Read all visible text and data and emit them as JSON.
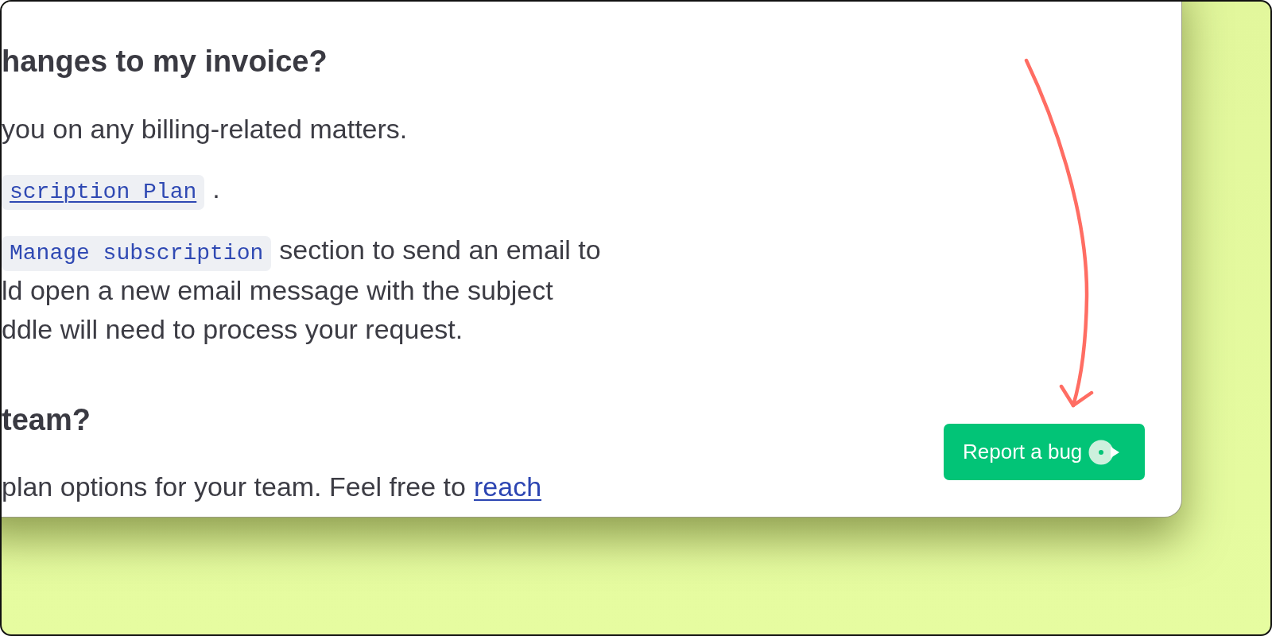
{
  "sections": [
    {
      "heading": "hanges to my invoice?",
      "blocks": [
        {
          "lines": [
            [
              {
                "kind": "text",
                "text": "you on any billing-related matters."
              }
            ]
          ]
        },
        {
          "lines": [
            [
              {
                "kind": "code_link",
                "text": "scription Plan"
              },
              {
                "kind": "text",
                "text": "."
              }
            ]
          ]
        },
        {
          "lines": [
            [
              {
                "kind": "code",
                "text": "Manage subscription"
              },
              {
                "kind": "text",
                "text": "section to send an email to"
              }
            ],
            [
              {
                "kind": "text",
                "text": "ld open a new email message with the subject"
              }
            ],
            [
              {
                "kind": "text",
                "text": "ddle will need to process your request."
              }
            ]
          ]
        }
      ]
    },
    {
      "heading": "team?",
      "blocks": [
        {
          "lines": [
            [
              {
                "kind": "text",
                "text": "plan options for your team. Feel free to"
              },
              {
                "kind": "link",
                "text": "reach"
              }
            ]
          ]
        }
      ]
    }
  ],
  "report_button": {
    "label": "Report a bug"
  }
}
